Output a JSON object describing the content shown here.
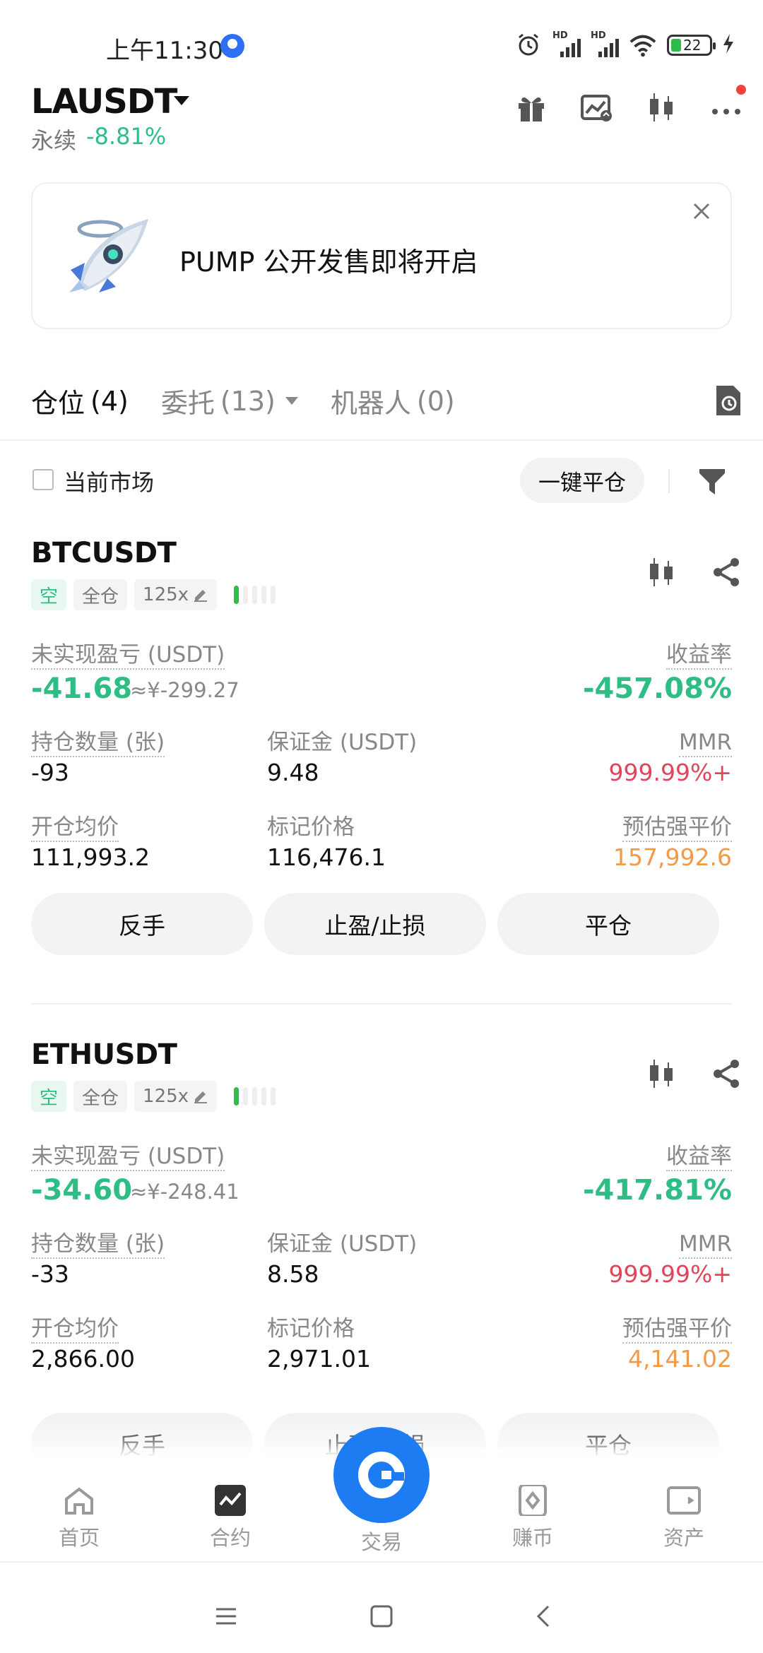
{
  "status_bar": {
    "time": "上午11:30",
    "signal_label_1": "HD",
    "signal_label_2": "HD",
    "battery": "22"
  },
  "header": {
    "pair": "LAUSDT",
    "contract_type": "永续",
    "change": "-8.81%",
    "icons": [
      "gift-icon",
      "chart-image-icon",
      "candlestick-icon",
      "more-icon"
    ]
  },
  "banner": {
    "text": "PUMP 公开发售即将开启",
    "image": "rocket-illustration"
  },
  "tabs": [
    {
      "label": "仓位",
      "count": "(4)"
    },
    {
      "label": "委托",
      "count": "(13)"
    },
    {
      "label": "机器人",
      "count": "(0)"
    }
  ],
  "filter": {
    "current_market_label": "当前市场",
    "close_all_label": "一键平仓"
  },
  "labels": {
    "unrealized_pnl": "未实现盈亏 (USDT)",
    "roe": "收益率",
    "size": "持仓数量 (张)",
    "margin": "保证金 (USDT)",
    "mmr": "MMR",
    "entry_price": "开仓均价",
    "mark_price": "标记价格",
    "liq_price": "预估强平价",
    "btn_reverse": "反手",
    "btn_tpsl": "止盈/止损",
    "btn_close": "平仓"
  },
  "positions": [
    {
      "symbol": "BTCUSDT",
      "side": "空",
      "margin_mode": "全仓",
      "leverage": "125x",
      "pnl": "-41.68",
      "pnl_cny": "≈¥-299.27",
      "roe": "-457.08%",
      "size": "-93",
      "margin": "9.48",
      "mmr": "999.99%+",
      "entry_price": "111,993.2",
      "mark_price": "116,476.1",
      "liq_price": "157,992.6"
    },
    {
      "symbol": "ETHUSDT",
      "side": "空",
      "margin_mode": "全仓",
      "leverage": "125x",
      "pnl": "-34.60",
      "pnl_cny": "≈¥-248.41",
      "roe": "-417.81%",
      "size": "-33",
      "margin": "8.58",
      "mmr": "999.99%+",
      "entry_price": "2,866.00",
      "mark_price": "2,971.01",
      "liq_price": "4,141.02"
    }
  ],
  "bottom_nav": [
    {
      "label": "首页",
      "icon": "home-icon"
    },
    {
      "label": "合约",
      "icon": "futures-icon"
    },
    {
      "label": "交易",
      "icon": "trade-icon"
    },
    {
      "label": "赚币",
      "icon": "earn-icon"
    },
    {
      "label": "资产",
      "icon": "wallet-icon"
    }
  ],
  "colors": {
    "green": "#2dbd85",
    "red": "#e0455a",
    "orange": "#f19a48",
    "accent": "#1d7cf2"
  }
}
